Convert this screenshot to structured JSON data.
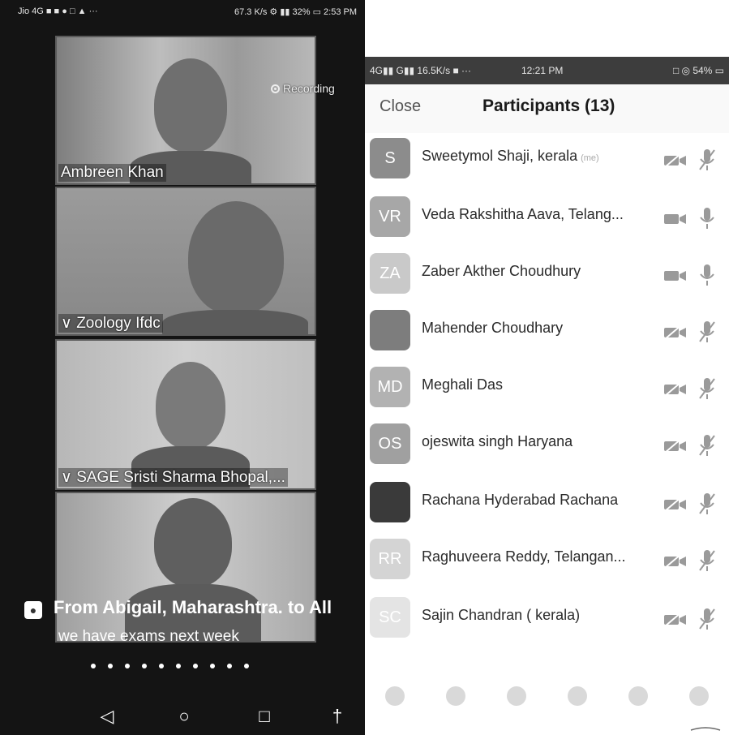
{
  "left_phone": {
    "status_left": "Jio 4G ■ ■ ● □ ▲ ···",
    "status_right": "67.3 K/s ⚙ ▮▮ 32% ▭ 2:53 PM",
    "recording_label": "Recording",
    "tiles": [
      {
        "name": "Ambreen Khan"
      },
      {
        "name": "Zoology Ifdc"
      },
      {
        "name": "SAGE Sristi Sharma Bhopal,..."
      },
      {
        "name": ""
      }
    ],
    "chat": {
      "from": "From Abigail, Maharashtra. to All",
      "message": "we have exams next week"
    }
  },
  "right_phone": {
    "status_left": "4G▮▮ G▮▮ 16.5K/s ■ ···",
    "status_time": "12:21 PM",
    "status_right": "□ ◎ 54% ▭",
    "close_label": "Close",
    "title": "Participants (13)",
    "participants": [
      {
        "initials": "S",
        "name": "Sweetymol Shaji, kerala",
        "me": "(me)",
        "avatar_color": "#8c8c8c",
        "cam_off": true,
        "mic_muted": true
      },
      {
        "initials": "VR",
        "name": "Veda Rakshitha Aava, Telang...",
        "me": "",
        "avatar_color": "#a7a7a7",
        "cam_off": false,
        "mic_muted": false
      },
      {
        "initials": "ZA",
        "name": "Zaber Akther Choudhury",
        "me": "",
        "avatar_color": "#c9c9c9",
        "cam_off": false,
        "mic_muted": false
      },
      {
        "initials": "",
        "name": "Mahender Choudhary",
        "me": "",
        "avatar_color": "#7d7d7d",
        "cam_off": true,
        "mic_muted": true
      },
      {
        "initials": "MD",
        "name": "Meghali Das",
        "me": "",
        "avatar_color": "#b2b2b2",
        "cam_off": true,
        "mic_muted": true
      },
      {
        "initials": "OS",
        "name": "ojeswita singh Haryana",
        "me": "",
        "avatar_color": "#a0a0a0",
        "cam_off": true,
        "mic_muted": true
      },
      {
        "initials": "",
        "name": "Rachana Hyderabad Rachana",
        "me": "",
        "avatar_color": "#3a3a3a",
        "cam_off": true,
        "mic_muted": true
      },
      {
        "initials": "RR",
        "name": "Raghuveera Reddy, Telangan...",
        "me": "",
        "avatar_color": "#d4d4d4",
        "cam_off": true,
        "mic_muted": true
      },
      {
        "initials": "SC",
        "name": "Sajin Chandran ( kerala)",
        "me": "",
        "avatar_color": "#e4e4e4",
        "cam_off": true,
        "mic_muted": true
      }
    ],
    "toolbar_icons": [
      "hand-raise-icon",
      "check-icon",
      "x-icon",
      "go-slower-icon",
      "go-faster-icon",
      "more-icon"
    ]
  }
}
